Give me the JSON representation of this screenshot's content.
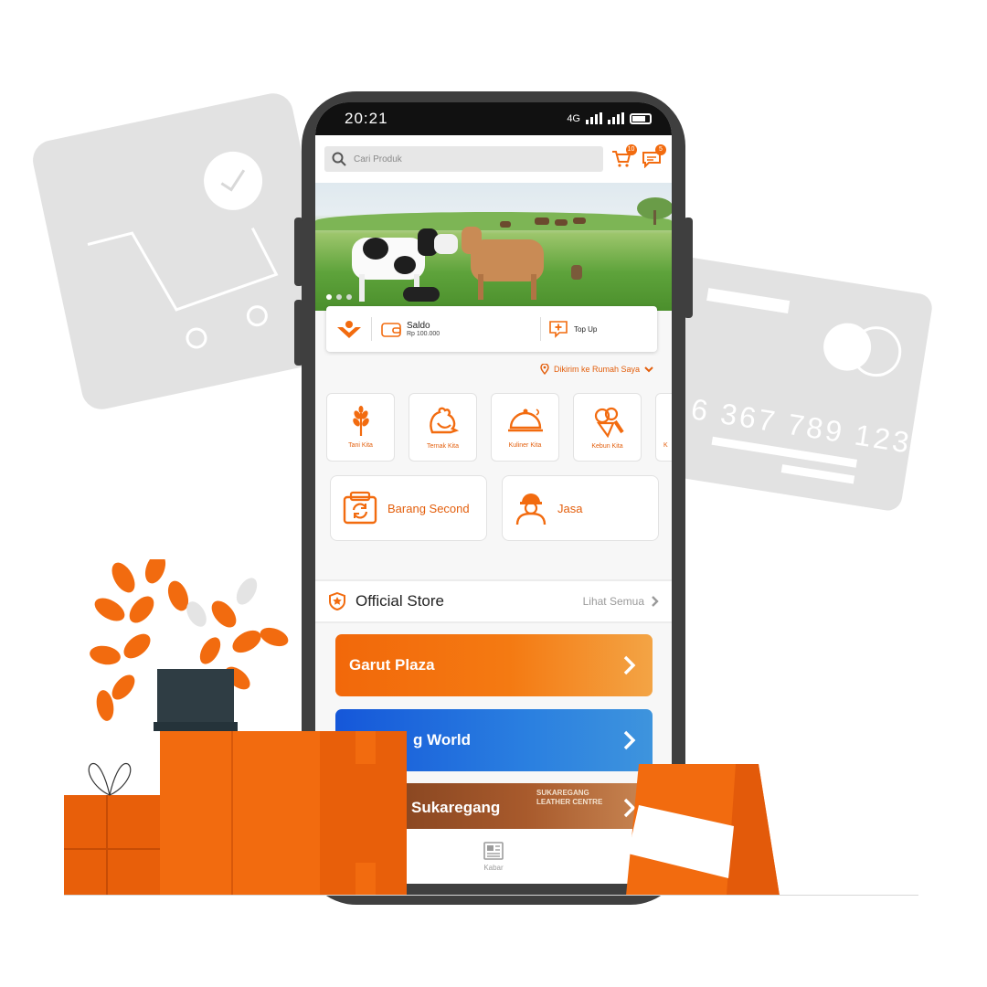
{
  "status_bar": {
    "time": "20:21",
    "network": "4G"
  },
  "search": {
    "placeholder": "Cari Produk"
  },
  "header_icons": {
    "cart_badge": "10",
    "chat_badge": "5"
  },
  "banner": {
    "slides": 3,
    "active_slide": 1
  },
  "wallet": {
    "label": "Saldo",
    "value": "Rp 100.000",
    "topup_label": "Top Up"
  },
  "delivery": {
    "label": "Dikirim ke Rumah Saya"
  },
  "categories": [
    {
      "label": "Tani Kita",
      "icon": "wheat-icon"
    },
    {
      "label": "Ternak Kita",
      "icon": "rooster-icon"
    },
    {
      "label": "Kuliner Kita",
      "icon": "cloche-icon"
    },
    {
      "label": "Kebun Kita",
      "icon": "vegetables-icon"
    },
    {
      "label": "K",
      "icon": "partial-icon"
    }
  ],
  "services": [
    {
      "label": "Barang Second",
      "icon": "recycle-box-icon"
    },
    {
      "label": "Jasa",
      "icon": "worker-icon"
    }
  ],
  "official_store": {
    "title": "Official Store",
    "see_all": "Lihat Semua"
  },
  "stores": [
    {
      "label": "Garut Plaza"
    },
    {
      "label": "g World"
    },
    {
      "label": "Sukaregang"
    }
  ],
  "store_images_text": {
    "sign": "SUKAREGANG LEATHER CENTRE"
  },
  "bottom_nav": {
    "news_label": "Kabar"
  },
  "decor": {
    "card_number": "6 367 789 123"
  },
  "colors": {
    "accent": "#f26b0f",
    "blue_store": "#1557d9",
    "brown_store": "#8a4622"
  }
}
